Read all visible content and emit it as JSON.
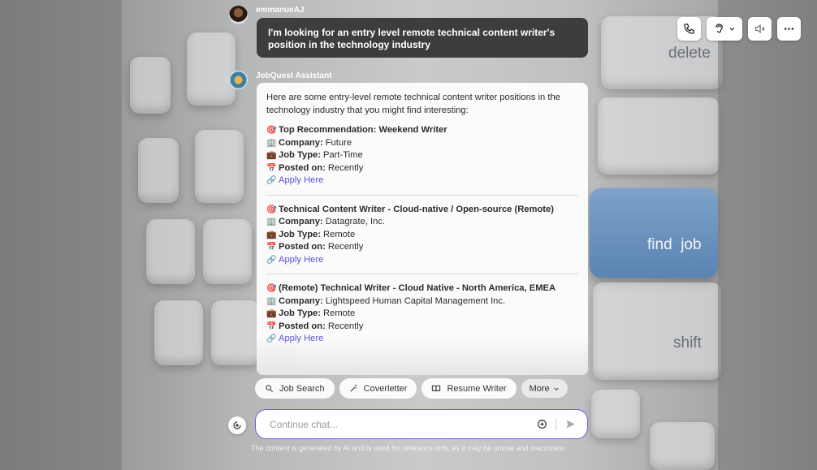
{
  "background": {
    "keys": {
      "delete": "delete",
      "find_job": "find  job",
      "shift": "shift"
    }
  },
  "header": {
    "call_icon": "phone-icon",
    "voice_icon": "ear-icon",
    "mute_icon": "speaker-mute-icon",
    "more_icon": "ellipsis-icon"
  },
  "messages": {
    "user": {
      "name": "emmanueAJ",
      "text": "I'm looking for an entry level remote technical content writer's position in the technology industry"
    },
    "assistant": {
      "name": "JobQuest Assistant",
      "intro": "Here are some entry-level remote technical content writer positions in the technology industry that you might find interesting:",
      "jobs": [
        {
          "title": "Top Recommendation: Weekend Writer",
          "company_label": "Company:",
          "company": "Future",
          "type_label": "Job Type:",
          "type": "Part-Time",
          "posted_label": "Posted on:",
          "posted": "Recently",
          "apply": "Apply Here"
        },
        {
          "title": "Technical Content Writer - Cloud-native / Open-source (Remote)",
          "company_label": "Company:",
          "company": "Datagrate, Inc.",
          "type_label": "Job Type:",
          "type": "Remote",
          "posted_label": "Posted on:",
          "posted": "Recently",
          "apply": "Apply Here"
        },
        {
          "title": "(Remote) Technical Writer - Cloud Native - North America, EMEA",
          "company_label": "Company:",
          "company": "Lightspeed Human Capital Management Inc.",
          "type_label": "Job Type:",
          "type": "Remote",
          "posted_label": "Posted on:",
          "posted": "Recently",
          "apply": "Apply Here"
        }
      ]
    }
  },
  "chips": [
    {
      "label": "Job Search",
      "icon": "search-icon"
    },
    {
      "label": "Coverletter",
      "icon": "magic-wand-icon"
    },
    {
      "label": "Resume Writer",
      "icon": "book-icon"
    }
  ],
  "more_label": "More",
  "composer": {
    "placeholder": "Continue chat...",
    "attach_icon": "attach-icon",
    "add_icon": "plus-circle-icon",
    "send_icon": "send-icon"
  },
  "disclaimer": "The content is generated by AI and is used for reference only, as it may be untrue and inaccurate.",
  "colors": {
    "accent": "#5a4fd6",
    "user_bubble": "#3c3d3f"
  }
}
